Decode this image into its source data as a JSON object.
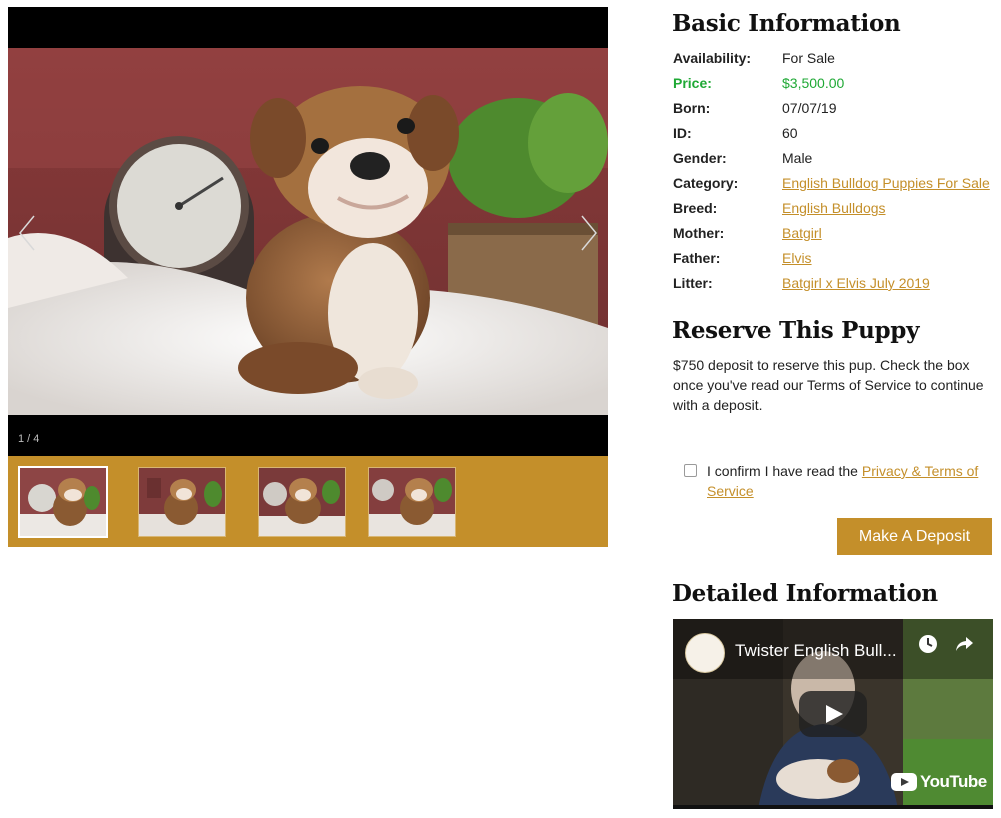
{
  "gallery": {
    "counter": "1 / 4",
    "thumbnail_count": 4,
    "active_thumbnail": 1,
    "prev_icon": "chevron-left-icon",
    "next_icon": "chevron-right-icon",
    "thumb_bar_color": "#c48f2a"
  },
  "basic": {
    "heading": "Basic Information",
    "rows": [
      {
        "label": "Availability:",
        "value": "For Sale",
        "link": false
      },
      {
        "label": "Price:",
        "value": "$3,500.00",
        "link": false
      },
      {
        "label": "Born:",
        "value": "07/07/19",
        "link": false
      },
      {
        "label": "ID:",
        "value": "60",
        "link": false
      },
      {
        "label": "Gender:",
        "value": "Male",
        "link": false
      },
      {
        "label": "Category:",
        "value": "English Bulldog Puppies For Sale",
        "link": true
      },
      {
        "label": "Breed:",
        "value": "English Bulldogs",
        "link": true
      },
      {
        "label": "Mother:",
        "value": "Batgirl",
        "link": true
      },
      {
        "label": "Father:",
        "value": "Elvis",
        "link": true
      },
      {
        "label": "Litter:",
        "value": "Batgirl x Elvis July 2019",
        "link": true
      }
    ],
    "price_color": "#1fa935"
  },
  "reserve": {
    "heading": "Reserve This Puppy",
    "text": "$750 deposit to reserve this pup. Check the box once you've read our Terms of Service to continue with a deposit.",
    "confirm_text": "I confirm I have read the ",
    "confirm_link": "Privacy & Terms of Service",
    "confirm_checked": false,
    "button": "Make A Deposit"
  },
  "detailed": {
    "heading": "Detailed Information",
    "video_title": "Twister English Bull...",
    "youtube_label": "YouTube",
    "icons": [
      "clock-icon",
      "share-icon",
      "play-icon"
    ]
  },
  "colors": {
    "accent": "#c48f2a",
    "link": "#c48f2a"
  }
}
